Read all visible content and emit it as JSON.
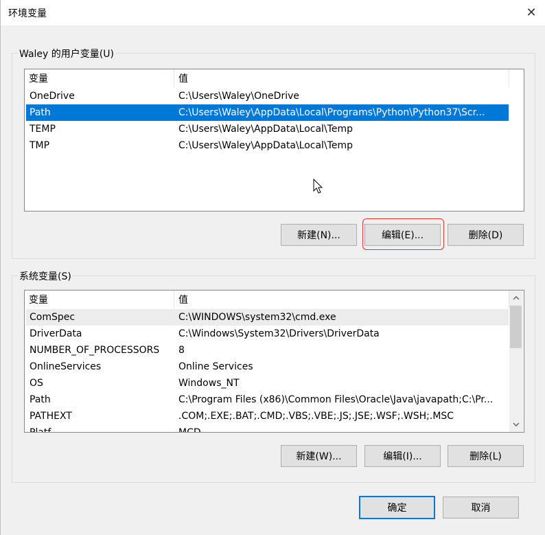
{
  "window": {
    "title": "环境变量",
    "close_glyph": "✕"
  },
  "user_vars": {
    "group_label": "Waley 的用户变量(U)",
    "col_name": "变量",
    "col_value": "值",
    "rows": [
      {
        "name": "OneDrive",
        "value": "C:\\Users\\Waley\\OneDrive"
      },
      {
        "name": "Path",
        "value": "C:\\Users\\Waley\\AppData\\Local\\Programs\\Python\\Python37\\Scr..."
      },
      {
        "name": "TEMP",
        "value": "C:\\Users\\Waley\\AppData\\Local\\Temp"
      },
      {
        "name": "TMP",
        "value": "C:\\Users\\Waley\\AppData\\Local\\Temp"
      }
    ],
    "selected_index": 1,
    "new_label": "新建(N)...",
    "edit_label": "编辑(E)...",
    "delete_label": "删除(D)"
  },
  "system_vars": {
    "group_label": "系统变量(S)",
    "col_name": "变量",
    "col_value": "值",
    "rows": [
      {
        "name": "ComSpec",
        "value": "C:\\WINDOWS\\system32\\cmd.exe"
      },
      {
        "name": "DriverData",
        "value": "C:\\Windows\\System32\\Drivers\\DriverData"
      },
      {
        "name": "NUMBER_OF_PROCESSORS",
        "value": "8"
      },
      {
        "name": "OnlineServices",
        "value": "Online Services"
      },
      {
        "name": "OS",
        "value": "Windows_NT"
      },
      {
        "name": "Path",
        "value": "C:\\Program Files (x86)\\Common Files\\Oracle\\Java\\javapath;C:\\Pr..."
      },
      {
        "name": "PATHEXT",
        "value": ".COM;.EXE;.BAT;.CMD;.VBS;.VBE;.JS;.JSE;.WSF;.WSH;.MSC"
      },
      {
        "name": "Platf...",
        "value": "MCD"
      }
    ],
    "new_label": "新建(W)...",
    "edit_label": "编辑(I)...",
    "delete_label": "删除(L)"
  },
  "footer": {
    "ok_label": "确定",
    "cancel_label": "取消"
  },
  "colors": {
    "selection": "#0078d7",
    "focus_ring": "#e0343b"
  }
}
